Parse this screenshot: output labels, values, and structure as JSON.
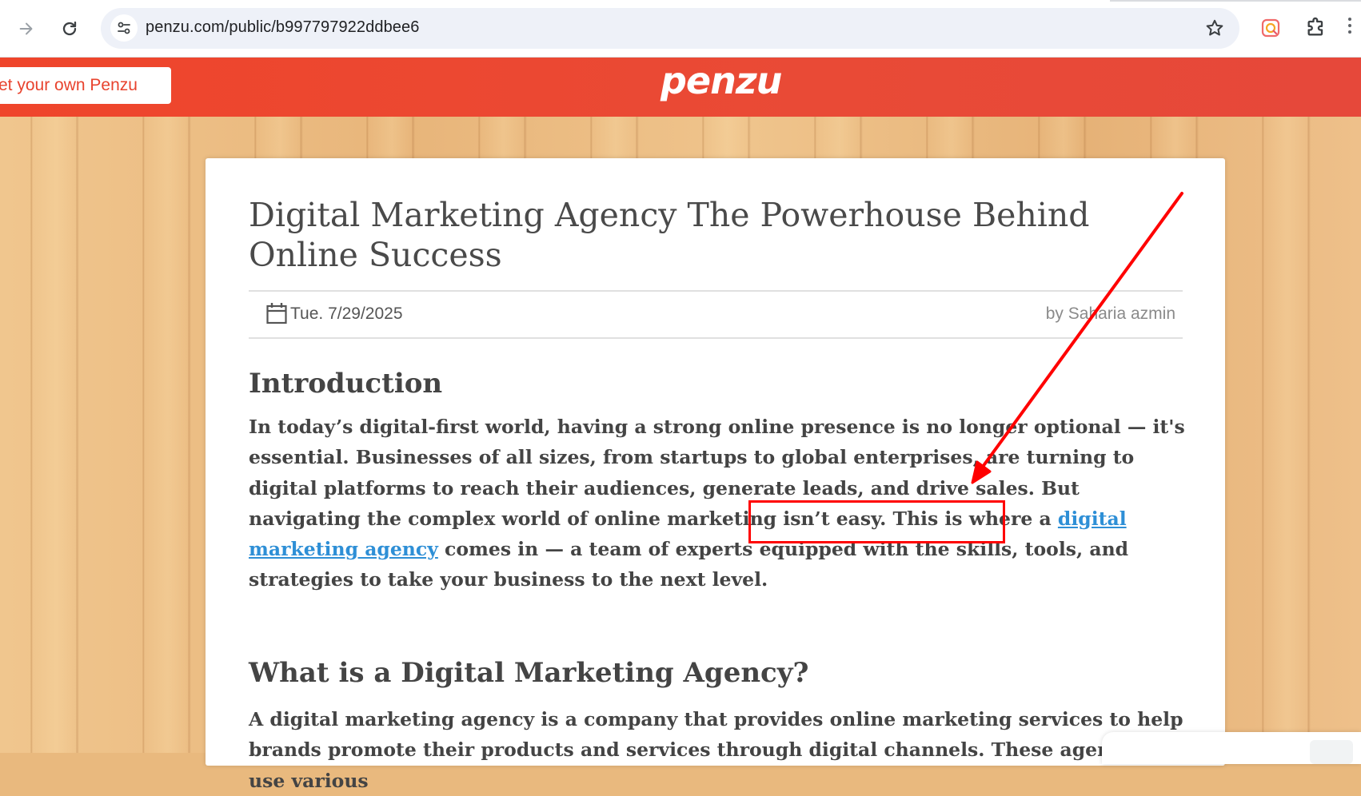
{
  "browser": {
    "url": "penzu.com/public/b997797922ddbee6"
  },
  "header": {
    "get_button_label": "et your own Penzu",
    "logo_text": "penzu",
    "brand_color": "#ef452b"
  },
  "entry": {
    "title": "Digital Marketing Agency The Powerhouse Behind Online Success",
    "date": "Tue. 7/29/2025",
    "author": "by Saharia azmin",
    "sections": [
      {
        "heading": "Introduction",
        "text_before_link": "In today’s digital-first world, having a strong online presence is no longer optional — it's essential. Businesses of all sizes, from startups to global enterprises, are turning to digital platforms to reach their audiences, generate leads, and drive sales. But navigating the complex world of online marketing isn’t easy. This is where a ",
        "link_text": "digital marketing agency",
        "text_after_link": " comes in — a team of experts equipped with the skills, tools, and strategies to take your business to the next level."
      },
      {
        "heading": "What is a Digital Marketing Agency?",
        "text": "A digital marketing agency is a company that provides online marketing services to help brands promote their products and services through digital channels. These agencies use various"
      }
    ],
    "link_color": "#2e8fd6"
  },
  "annotation": {
    "color": "#ff0000"
  }
}
